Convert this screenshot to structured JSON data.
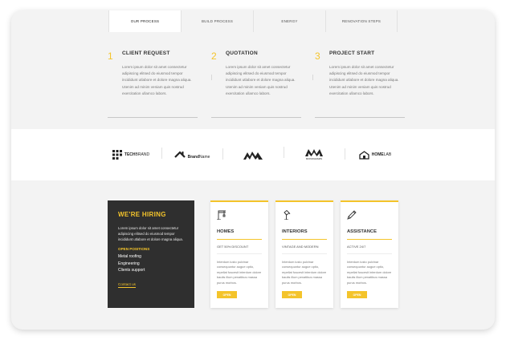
{
  "tabs": [
    {
      "label": "OUR PROCESS",
      "active": true
    },
    {
      "label": "BUILD PROCESS",
      "active": false
    },
    {
      "label": "ENERGY",
      "active": false
    },
    {
      "label": "RENOVATION STEPS",
      "active": false
    }
  ],
  "steps": [
    {
      "number": "1",
      "title": "CLIENT REQUEST",
      "text": "Lorem ipsum dolor sit amet consectetur adipiscing elitsed do eiusmod tempor incididunt utlabore et dolore magna aliqua. Utenim ad minim veniam quis nostrud exercitation ullamco labors."
    },
    {
      "number": "2",
      "title": "QUOTATION",
      "text": "Lorem ipsum dolor sit amet consectetur adipiscing elitsed do eiusmod tempor incididunt utlabore et dolore magna aliqua. Utenim ad minim veniam quis nostrud exercitation ullamco labors."
    },
    {
      "number": "3",
      "title": "PROJECT START",
      "text": "Lorem ipsum dolor sit amet consectetur adipiscing elitsed do eiusmod tempor incididunt utlabore et dolore magna aliqua. Utenim ad minim veniam quis nostrud exercitation ullamco labors."
    }
  ],
  "brands": [
    {
      "icon": "techbrand-logo-icon",
      "bold": "TECH",
      "rest": "BRAND"
    },
    {
      "icon": "brandname-logo-icon",
      "bold": "Brand",
      "rest": "Name"
    },
    {
      "icon": "peaks-logo-icon",
      "bold": "",
      "rest": ""
    },
    {
      "icon": "monogram-logo-icon",
      "bold": "",
      "rest": "MONOGRAMS"
    },
    {
      "icon": "homelab-logo-icon",
      "bold": "HOME",
      "rest": "LAB"
    }
  ],
  "hiring": {
    "title": "WE'RE HIRING",
    "text": "Lorem ipsum dolor sit amet consectetur adipiscing elitsed do eiusmod tempor incididunt utlabore et dolore magna aliqua.",
    "open_title": "OPEN POSITIONS",
    "positions": [
      "Metal roofing",
      "Engineering",
      "Clients support"
    ],
    "contact": "Contact us"
  },
  "cards": [
    {
      "icon": "crane-icon",
      "title": "HOMES",
      "subtitle": "GET 50% DISCOUNT",
      "text": "Interdum iusto pulvinar consequuntur augue optio, repellat fuscesit interdum dolore bautis illum penatibus massa purus morbos.",
      "button": "OPEN"
    },
    {
      "icon": "lamp-icon",
      "title": "INTERIORS",
      "subtitle": "VINTAGE AND MODERN",
      "text": "Interdum iusto pulvinar consequuntur augue optio, repellat fuscesit interdum dolore bautis illum penatibus massa purus morbos.",
      "button": "OPEN"
    },
    {
      "icon": "pencil-icon",
      "title": "ASSISTANCE",
      "subtitle": "ACTIVE 24/7",
      "text": "Interdum iusto pulvinar consequuntur augue optio, repellat fuscesit interdum dolore bautis illum penatibus massa purus morbos.",
      "button": "OPEN"
    }
  ],
  "colors": {
    "accent": "#f4c42b",
    "dark": "#2f2f2f",
    "background": "#f3f3f3"
  }
}
